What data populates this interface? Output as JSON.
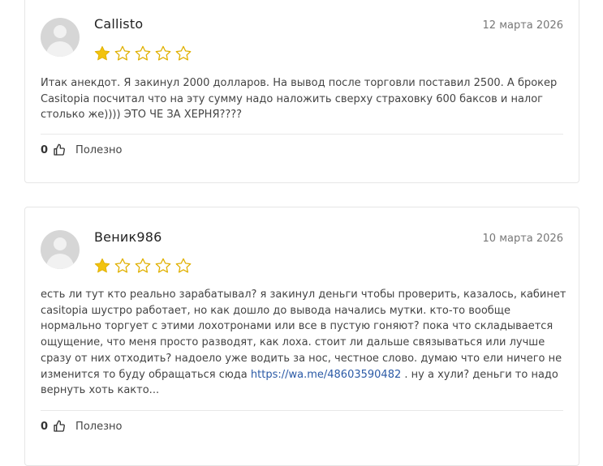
{
  "reviews": [
    {
      "author": "Callisto",
      "date": "12 марта 2026",
      "rating": 1,
      "max_rating": 5,
      "text_lines": [
        "Итак анекдот. Я закинул 2000 долларов. На вывод после торговли поставил 2500. А брокер",
        "Casitopia посчитал что на эту сумму надо наложить сверху страховку 600 баксов и налог",
        "столько же)))) ЭТО ЧЕ ЗА ХЕРНЯ????"
      ],
      "helpful_count": "0",
      "helpful_label": "Полезно"
    },
    {
      "author": "Веник986",
      "date": "10 марта 2026",
      "rating": 1,
      "max_rating": 5,
      "text_lines": [
        "есть ли тут кто реально зарабатывал? я закинул деньги чтобы проверить, казалось, кабинет",
        "casitopia шустро работает, но как дошло до вывода начались мутки. кто-то вообще",
        "нормально торгует с этими лохотронами или все в пустую гоняют? пока что складывается",
        "ощущение, что меня просто разводят, как лоха. стоит ли дальше связываться или лучше",
        "сразу от них отходить? надоело уже водить за нос, честное слово. думаю что ели ничего не"
      ],
      "text_line6_before": "изменится то буду обращаться сюда ",
      "text_link": "https://wa.me/48603590482",
      "text_line6_after": " . ну а хули? деньги то надо",
      "text_line7": "вернуть хоть както...",
      "helpful_count": "0",
      "helpful_label": "Полезно"
    }
  ],
  "colors": {
    "star_filled": "#f2c30f",
    "star_empty_stroke": "#e0b000",
    "link": "#2b5aa6"
  },
  "icons": {
    "avatar": "user-placeholder-icon",
    "star": "star-icon",
    "helpful": "thumbs-up-icon"
  }
}
